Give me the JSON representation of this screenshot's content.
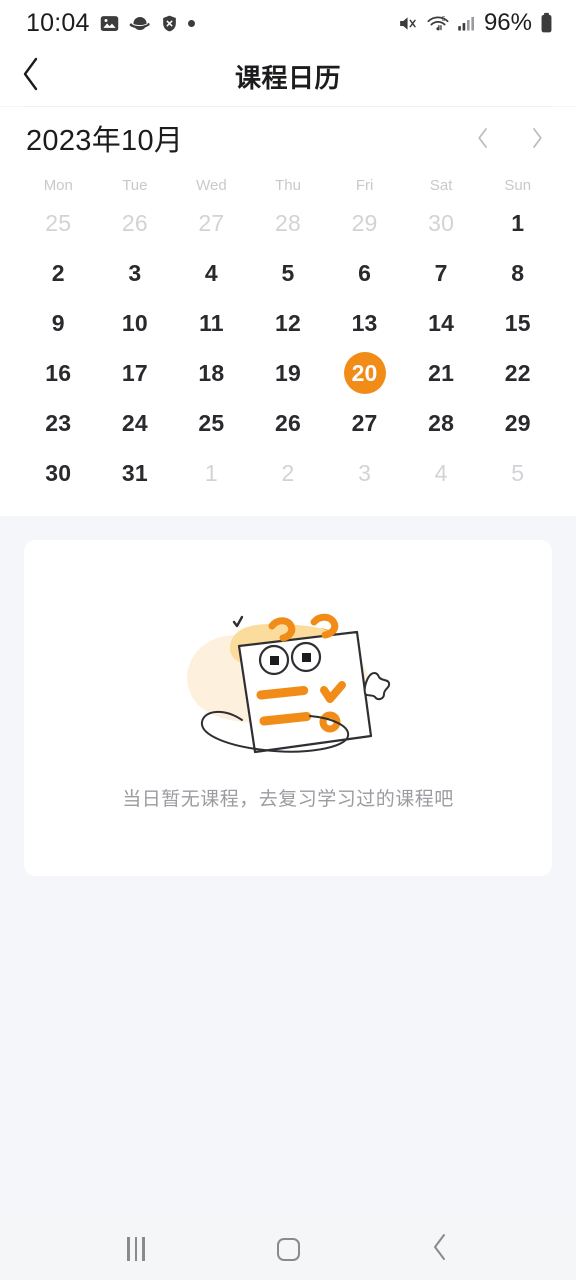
{
  "status_bar": {
    "time": "10:04",
    "battery_percent": "96%",
    "left_icons": [
      "image-icon",
      "planet-icon",
      "shield-x-icon",
      "dot-icon"
    ],
    "right_icons": [
      "mute-icon",
      "wifi-icon",
      "signal-icon",
      "battery-icon"
    ]
  },
  "header": {
    "back_icon": "chevron-left-icon",
    "title": "课程日历"
  },
  "calendar": {
    "month_label": "2023年10月",
    "prev_icon": "chevron-left-icon",
    "next_icon": "chevron-right-icon",
    "weekdays": [
      "Mon",
      "Tue",
      "Wed",
      "Thu",
      "Fri",
      "Sat",
      "Sun"
    ],
    "selected_day": "20",
    "accent_color": "#f08c17",
    "weeks": [
      [
        {
          "label": "25",
          "muted": true
        },
        {
          "label": "26",
          "muted": true
        },
        {
          "label": "27",
          "muted": true
        },
        {
          "label": "28",
          "muted": true
        },
        {
          "label": "29",
          "muted": true
        },
        {
          "label": "30",
          "muted": true
        },
        {
          "label": "1",
          "muted": false
        }
      ],
      [
        {
          "label": "2",
          "muted": false
        },
        {
          "label": "3",
          "muted": false
        },
        {
          "label": "4",
          "muted": false
        },
        {
          "label": "5",
          "muted": false
        },
        {
          "label": "6",
          "muted": false
        },
        {
          "label": "7",
          "muted": false
        },
        {
          "label": "8",
          "muted": false
        }
      ],
      [
        {
          "label": "9",
          "muted": false
        },
        {
          "label": "10",
          "muted": false
        },
        {
          "label": "11",
          "muted": false
        },
        {
          "label": "12",
          "muted": false
        },
        {
          "label": "13",
          "muted": false
        },
        {
          "label": "14",
          "muted": false
        },
        {
          "label": "15",
          "muted": false
        }
      ],
      [
        {
          "label": "16",
          "muted": false
        },
        {
          "label": "17",
          "muted": false
        },
        {
          "label": "18",
          "muted": false
        },
        {
          "label": "19",
          "muted": false
        },
        {
          "label": "20",
          "muted": false,
          "selected": true
        },
        {
          "label": "21",
          "muted": false
        },
        {
          "label": "22",
          "muted": false
        }
      ],
      [
        {
          "label": "23",
          "muted": false
        },
        {
          "label": "24",
          "muted": false
        },
        {
          "label": "25",
          "muted": false
        },
        {
          "label": "26",
          "muted": false
        },
        {
          "label": "27",
          "muted": false
        },
        {
          "label": "28",
          "muted": false
        },
        {
          "label": "29",
          "muted": false
        }
      ],
      [
        {
          "label": "30",
          "muted": false
        },
        {
          "label": "31",
          "muted": false
        },
        {
          "label": "1",
          "muted": true
        },
        {
          "label": "2",
          "muted": true
        },
        {
          "label": "3",
          "muted": true
        },
        {
          "label": "4",
          "muted": true
        },
        {
          "label": "5",
          "muted": true
        }
      ]
    ]
  },
  "empty_state": {
    "illustration": "notepad-character-illustration",
    "message": "当日暂无课程，去复习学习过的课程吧"
  },
  "nav_bar": {
    "recents_icon": "recents-icon",
    "home_icon": "home-icon",
    "back_icon": "chevron-left-icon"
  }
}
